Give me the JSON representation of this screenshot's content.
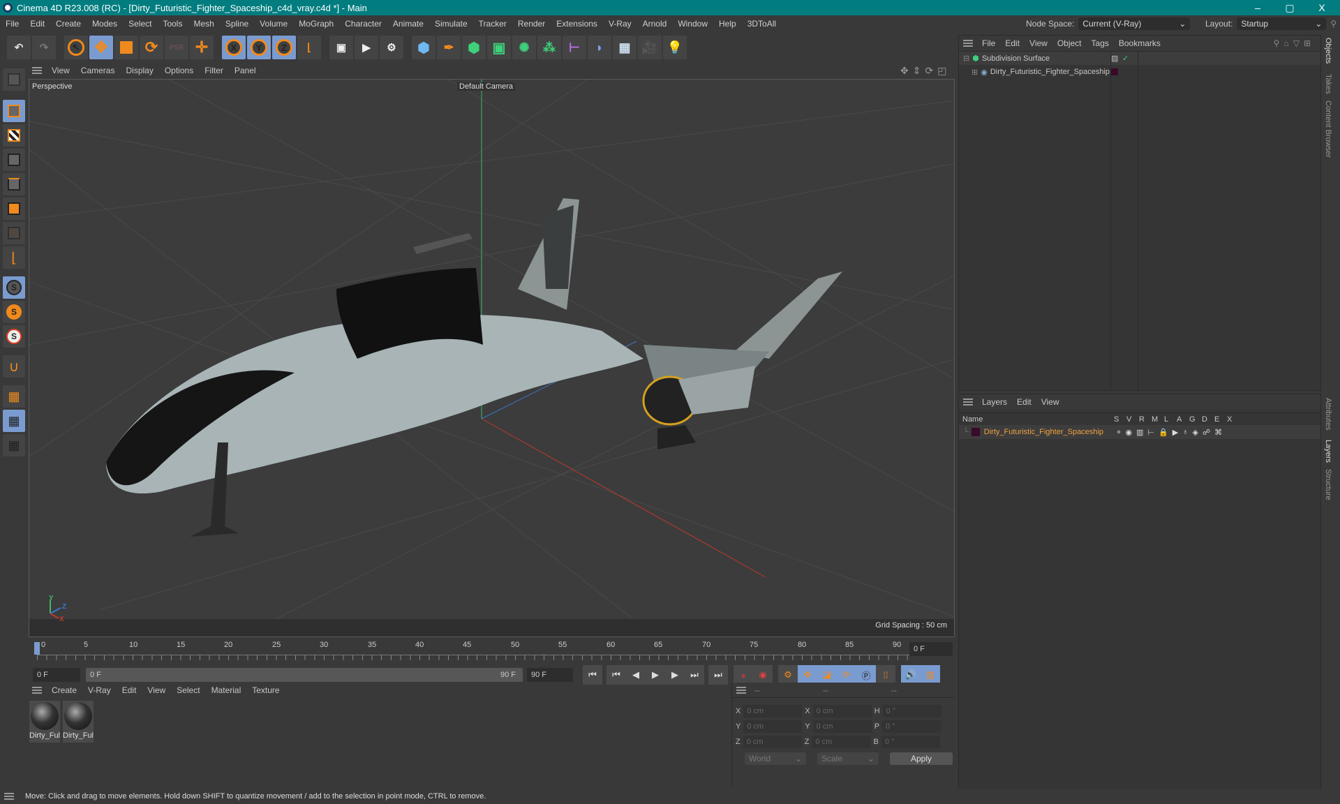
{
  "title": "Cinema 4D R23.008 (RC) - [Dirty_Futuristic_Fighter_Spaceship_c4d_vray.c4d *] - Main",
  "window_controls": {
    "minimize": "–",
    "maximize": "▢",
    "close": "X"
  },
  "menu": [
    "File",
    "Edit",
    "Create",
    "Modes",
    "Select",
    "Tools",
    "Mesh",
    "Spline",
    "Volume",
    "MoGraph",
    "Character",
    "Animate",
    "Simulate",
    "Tracker",
    "Render",
    "Extensions",
    "V-Ray",
    "Arnold",
    "Window",
    "Help",
    "3DToAll"
  ],
  "node_space": {
    "label": "Node Space:",
    "value": "Current (V-Ray)"
  },
  "layout": {
    "label": "Layout:",
    "value": "Startup"
  },
  "toolbar": [
    "undo-icon",
    "redo-icon",
    "select-icon",
    "move-icon",
    "scale-icon",
    "rotate-icon",
    "psr-icon",
    "axis-icon",
    "x-axis-icon",
    "y-axis-icon",
    "z-axis-icon",
    "coordinate-system-icon",
    "render-view-icon",
    "render-icon",
    "render-settings-icon",
    "cube-icon",
    "pen-icon",
    "subdivision-icon",
    "extrude-icon",
    "cloner-icon",
    "mograph-icon",
    "symmetry-icon",
    "deformer-icon",
    "floor-icon",
    "camera-icon",
    "light-icon"
  ],
  "toolbar_xyz": [
    "X",
    "Y",
    "Z"
  ],
  "viewport": {
    "menu": [
      "View",
      "Cameras",
      "Display",
      "Options",
      "Filter",
      "Panel"
    ],
    "label": "Perspective",
    "camera": "Default Camera",
    "grid_spacing": "Grid Spacing : 50 cm",
    "axis": {
      "x": "X",
      "y": "Y",
      "z": "Z"
    }
  },
  "timeline": {
    "ticks": [
      "0",
      "5",
      "10",
      "15",
      "20",
      "25",
      "30",
      "35",
      "40",
      "45",
      "50",
      "55",
      "60",
      "65",
      "70",
      "75",
      "80",
      "85",
      "90"
    ],
    "current_frame": "0 F",
    "start": "0 F",
    "range_start": "0 F",
    "range_end": "90 F",
    "end": "90 F"
  },
  "materials": {
    "menu": [
      "Create",
      "V-Ray",
      "Edit",
      "View",
      "Select",
      "Material",
      "Texture"
    ],
    "items": [
      {
        "name": "Dirty_Ful"
      },
      {
        "name": "Dirty_Ful"
      }
    ]
  },
  "coords": {
    "headers": [
      "--",
      "--",
      "--"
    ],
    "rows": [
      {
        "a": "X",
        "av": "0 cm",
        "b": "X",
        "bv": "0 cm",
        "c": "H",
        "cv": "0 °"
      },
      {
        "a": "Y",
        "av": "0 cm",
        "b": "Y",
        "bv": "0 cm",
        "c": "P",
        "cv": "0 °"
      },
      {
        "a": "Z",
        "av": "0 cm",
        "b": "Z",
        "bv": "0 cm",
        "c": "B",
        "cv": "0 °"
      }
    ],
    "mode": "World",
    "transform": "Scale",
    "apply": "Apply"
  },
  "objects": {
    "menu": [
      "File",
      "Edit",
      "View",
      "Object",
      "Tags",
      "Bookmarks"
    ],
    "items": [
      {
        "name": "Subdivision Surface"
      },
      {
        "name": "Dirty_Futuristic_Fighter_Spaceship"
      }
    ]
  },
  "layers": {
    "menu": [
      "Layers",
      "Edit",
      "View"
    ],
    "columns": [
      "Name",
      "S",
      "V",
      "R",
      "M",
      "L",
      "A",
      "G",
      "D",
      "E",
      "X"
    ],
    "items": [
      {
        "name": "Dirty_Futuristic_Fighter_Spaceship",
        "color": "#3a0a2a"
      }
    ]
  },
  "side_tabs": [
    "Objects",
    "Takes",
    "Content Browser",
    "Attributes",
    "Layers",
    "Structure"
  ],
  "status": "Move: Click and drag to move elements. Hold down SHIFT to quantize movement / add to the selection in point mode, CTRL to remove.",
  "colors": {
    "titlebar": "#017d80",
    "accent_orange": "#f08a1c",
    "selected_blue": "#7a9bd0",
    "layer_name": "#f0a040"
  }
}
